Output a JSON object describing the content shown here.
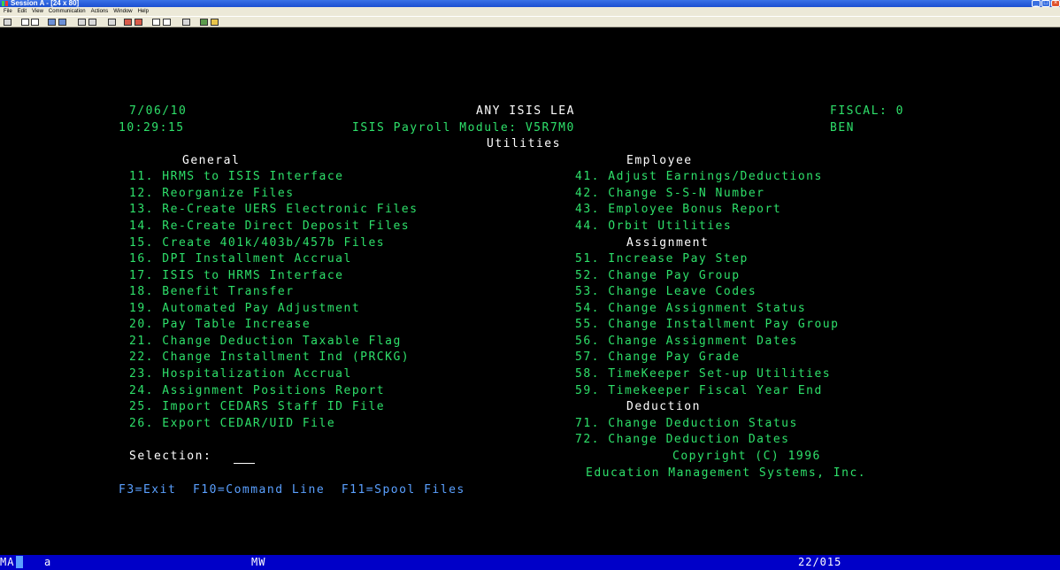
{
  "window": {
    "title": "Session A - [24 x 80]",
    "controls": [
      "_",
      "□",
      "×"
    ]
  },
  "menu": [
    "File",
    "Edit",
    "View",
    "Communication",
    "Actions",
    "Window",
    "Help"
  ],
  "toolbar_icons": [
    "print-screen-icon",
    "copy-icon",
    "paste-icon",
    "send-icon",
    "receive-icon",
    "display-icon",
    "color-icon",
    "map-icon",
    "record-macro-icon",
    "play-macro-icon",
    "stop-macro-icon",
    "macro-list-icon",
    "customize-icon",
    "support-icon",
    "help-icon"
  ],
  "header": {
    "date": "7/06/10",
    "time": "10:29:15",
    "org": "ANY ISIS LEA",
    "module": "ISIS Payroll Module: V5R7M0",
    "screen_title": "Utilities",
    "fiscal": "FISCAL: 0",
    "user": "BEN"
  },
  "general": {
    "heading": "General",
    "items": [
      "11. HRMS to ISIS Interface",
      "12. Reorganize Files",
      "13. Re-Create UERS Electronic Files",
      "14. Re-Create Direct Deposit Files",
      "15. Create 401k/403b/457b Files",
      "16. DPI Installment Accrual",
      "17. ISIS to HRMS Interface",
      "18. Benefit Transfer",
      "19. Automated Pay Adjustment",
      "20. Pay Table Increase",
      "21. Change Deduction Taxable Flag",
      "22. Change Installment Ind (PRCKG)",
      "23. Hospitalization Accrual",
      "24. Assignment Positions Report",
      "25. Import CEDARS Staff ID File",
      "26. Export CEDAR/UID File"
    ]
  },
  "employee": {
    "heading": "Employee",
    "items": [
      "41. Adjust Earnings/Deductions",
      "42. Change S-S-N Number",
      "43. Employee Bonus Report",
      "44. Orbit Utilities"
    ]
  },
  "assignment": {
    "heading": "Assignment",
    "items": [
      "51. Increase Pay Step",
      "52. Change Pay Group",
      "53. Change Leave Codes",
      "54. Change Assignment Status",
      "55. Change Installment Pay Group",
      "56. Change Assignment Dates",
      "57. Change Pay Grade",
      "58. TimeKeeper Set-up Utilities",
      "59. Timekeeper Fiscal Year End"
    ]
  },
  "deduction": {
    "heading": "Deduction",
    "items": [
      "71. Change Deduction Status",
      "72. Change Deduction Dates"
    ]
  },
  "selection": {
    "label": "Selection:",
    "value": ""
  },
  "copyright": {
    "line1": "Copyright (C) 1996",
    "line2": "Education Management Systems, Inc."
  },
  "function_keys": "F3=Exit  F10=Command Line  F11=Spool Files",
  "status": {
    "mode": "MA",
    "session": "a",
    "indicator": "MW",
    "cursor": "22/015"
  }
}
